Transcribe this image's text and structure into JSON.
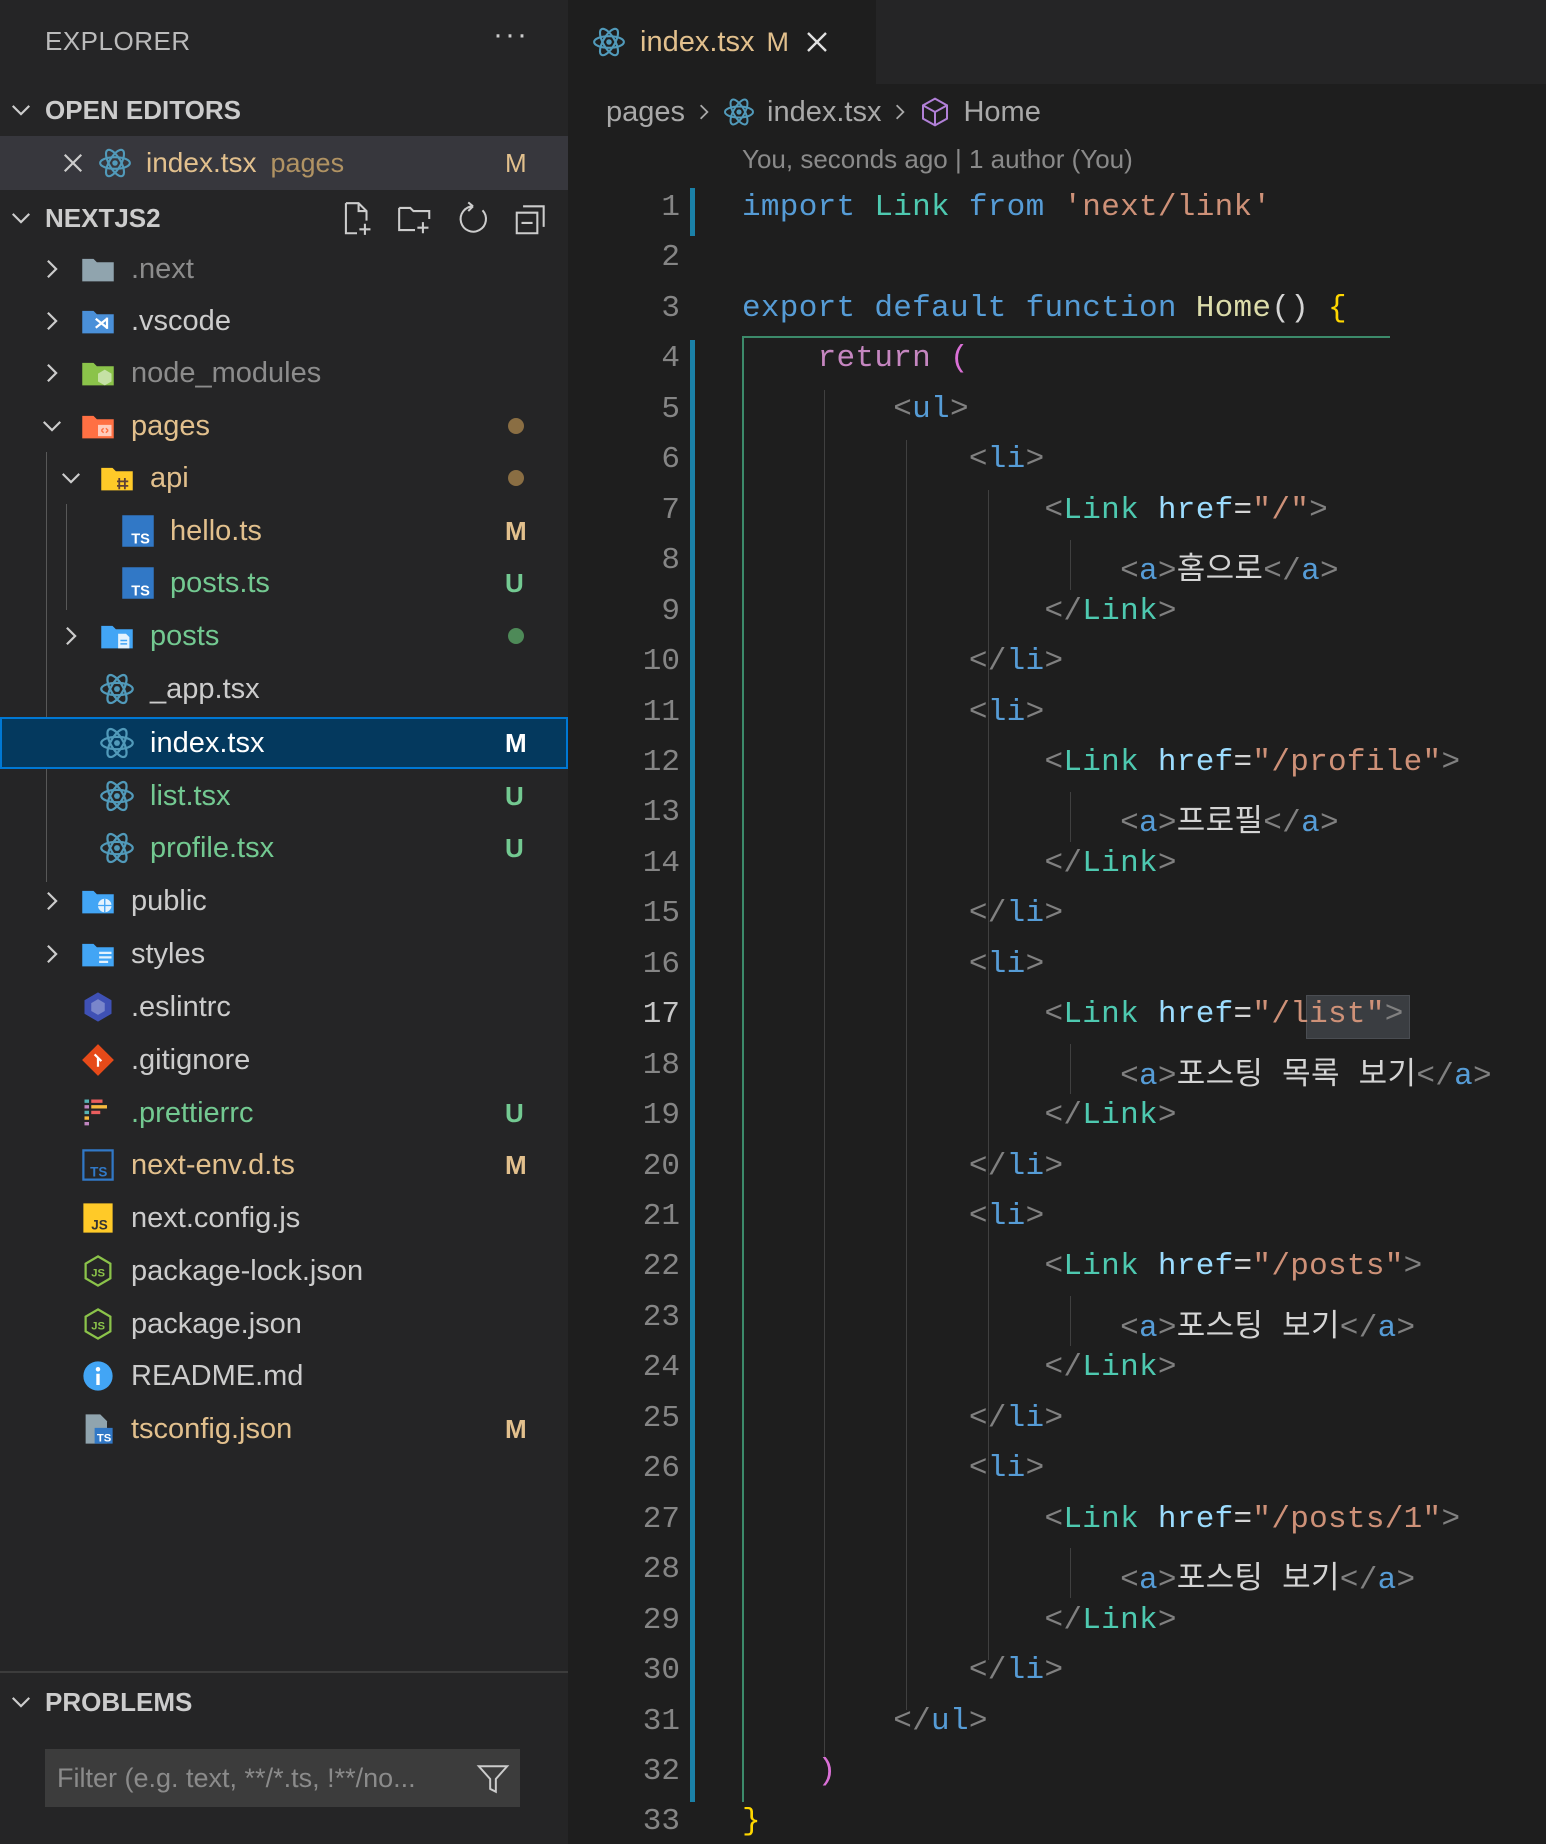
{
  "explorer": {
    "title": "EXPLORER",
    "more": "···",
    "open_editors": {
      "heading": "OPEN EDITORS",
      "items": [
        {
          "name": "index.tsx",
          "dir": "pages",
          "status": "M"
        }
      ]
    },
    "project": {
      "heading": "NEXTJS2",
      "tools": [
        "new-file-icon",
        "new-folder-icon",
        "refresh-icon",
        "collapse-all-icon"
      ],
      "tree": [
        {
          "label": ".next",
          "status": "",
          "dot": ""
        },
        {
          "label": ".vscode",
          "status": "",
          "dot": ""
        },
        {
          "label": "node_modules",
          "status": "",
          "dot": ""
        },
        {
          "label": "pages",
          "status": "",
          "dot": "#8a6e43"
        },
        {
          "label": "api",
          "status": "",
          "dot": "#8a6e43"
        },
        {
          "label": "hello.ts",
          "status": "M",
          "dot": ""
        },
        {
          "label": "posts.ts",
          "status": "U",
          "dot": ""
        },
        {
          "label": "posts",
          "status": "",
          "dot": "#4e8a58"
        },
        {
          "label": "_app.tsx",
          "status": "",
          "dot": ""
        },
        {
          "label": "index.tsx",
          "status": "M",
          "dot": ""
        },
        {
          "label": "list.tsx",
          "status": "U",
          "dot": ""
        },
        {
          "label": "profile.tsx",
          "status": "U",
          "dot": ""
        },
        {
          "label": "public",
          "status": "",
          "dot": ""
        },
        {
          "label": "styles",
          "status": "",
          "dot": ""
        },
        {
          "label": ".eslintrc",
          "status": "",
          "dot": ""
        },
        {
          "label": ".gitignore",
          "status": "",
          "dot": ""
        },
        {
          "label": ".prettierrc",
          "status": "U",
          "dot": ""
        },
        {
          "label": "next-env.d.ts",
          "status": "M",
          "dot": ""
        },
        {
          "label": "next.config.js",
          "status": "",
          "dot": ""
        },
        {
          "label": "package-lock.json",
          "status": "",
          "dot": ""
        },
        {
          "label": "package.json",
          "status": "",
          "dot": ""
        },
        {
          "label": "README.md",
          "status": "",
          "dot": ""
        },
        {
          "label": "tsconfig.json",
          "status": "M",
          "dot": ""
        }
      ]
    },
    "problems": {
      "heading": "PROBLEMS",
      "filter_placeholder": "Filter (e.g. text, **/*.ts, !**/no..."
    }
  },
  "editor": {
    "tab": {
      "name": "index.tsx",
      "status": "M"
    },
    "breadcrumb": {
      "folder": "pages",
      "file": "index.tsx",
      "symbol": "Home"
    },
    "blame": "You, seconds ago | 1 author (You)",
    "active_line": 17,
    "lines": [
      [
        "1"
      ],
      [
        "2"
      ],
      [
        "3"
      ],
      [
        "4"
      ],
      [
        "5"
      ],
      [
        "6"
      ],
      [
        "7"
      ],
      [
        "8"
      ],
      [
        "9"
      ],
      [
        "10"
      ],
      [
        "11"
      ],
      [
        "12"
      ],
      [
        "13"
      ],
      [
        "14"
      ],
      [
        "15"
      ],
      [
        "16"
      ],
      [
        "17"
      ],
      [
        "18"
      ],
      [
        "19"
      ],
      [
        "20"
      ],
      [
        "21"
      ],
      [
        "22"
      ],
      [
        "23"
      ],
      [
        "24"
      ],
      [
        "25"
      ],
      [
        "26"
      ],
      [
        "27"
      ],
      [
        "28"
      ],
      [
        "29"
      ],
      [
        "30"
      ],
      [
        "31"
      ],
      [
        "32"
      ],
      [
        "33"
      ]
    ],
    "code": [
      [
        [
          "kw",
          "import"
        ],
        [
          "txt",
          " "
        ],
        [
          "var",
          "Link"
        ],
        [
          "txt",
          " "
        ],
        [
          "kw",
          "from"
        ],
        [
          "txt",
          " "
        ],
        [
          "str",
          "'next/link'"
        ]
      ],
      [],
      [
        [
          "kw",
          "export"
        ],
        [
          "txt",
          " "
        ],
        [
          "kw",
          "default"
        ],
        [
          "txt",
          " "
        ],
        [
          "kw",
          "function"
        ],
        [
          "txt",
          " "
        ],
        [
          "fn",
          "Home"
        ],
        [
          "txt",
          "() "
        ],
        [
          "brace",
          "{"
        ]
      ],
      [
        [
          "txt",
          "    "
        ],
        [
          "ctl",
          "return"
        ],
        [
          "txt",
          " "
        ],
        [
          "brace2",
          "("
        ]
      ],
      [
        [
          "txt",
          "        "
        ],
        [
          "punc",
          "<"
        ],
        [
          "tag",
          "ul"
        ],
        [
          "punc",
          ">"
        ]
      ],
      [
        [
          "txt",
          "            "
        ],
        [
          "punc",
          "<"
        ],
        [
          "tag",
          "li"
        ],
        [
          "punc",
          ">"
        ]
      ],
      [
        [
          "txt",
          "                "
        ],
        [
          "punc",
          "<"
        ],
        [
          "comp",
          "Link"
        ],
        [
          "txt",
          " "
        ],
        [
          "attr",
          "href"
        ],
        [
          "txt",
          "="
        ],
        [
          "str",
          "\"/\""
        ],
        [
          "punc",
          ">"
        ]
      ],
      [
        [
          "txt",
          "                    "
        ],
        [
          "punc",
          "<"
        ],
        [
          "tag",
          "a"
        ],
        [
          "punc",
          ">"
        ],
        [
          "txt",
          "홈으로"
        ],
        [
          "punc",
          "</"
        ],
        [
          "tag",
          "a"
        ],
        [
          "punc",
          ">"
        ]
      ],
      [
        [
          "txt",
          "                "
        ],
        [
          "punc",
          "</"
        ],
        [
          "comp",
          "Link"
        ],
        [
          "punc",
          ">"
        ]
      ],
      [
        [
          "txt",
          "            "
        ],
        [
          "punc",
          "</"
        ],
        [
          "tag",
          "li"
        ],
        [
          "punc",
          ">"
        ]
      ],
      [
        [
          "txt",
          "            "
        ],
        [
          "punc",
          "<"
        ],
        [
          "tag",
          "li"
        ],
        [
          "punc",
          ">"
        ]
      ],
      [
        [
          "txt",
          "                "
        ],
        [
          "punc",
          "<"
        ],
        [
          "comp",
          "Link"
        ],
        [
          "txt",
          " "
        ],
        [
          "attr",
          "href"
        ],
        [
          "txt",
          "="
        ],
        [
          "str",
          "\"/profile\""
        ],
        [
          "punc",
          ">"
        ]
      ],
      [
        [
          "txt",
          "                    "
        ],
        [
          "punc",
          "<"
        ],
        [
          "tag",
          "a"
        ],
        [
          "punc",
          ">"
        ],
        [
          "txt",
          "프로필"
        ],
        [
          "punc",
          "</"
        ],
        [
          "tag",
          "a"
        ],
        [
          "punc",
          ">"
        ]
      ],
      [
        [
          "txt",
          "                "
        ],
        [
          "punc",
          "</"
        ],
        [
          "comp",
          "Link"
        ],
        [
          "punc",
          ">"
        ]
      ],
      [
        [
          "txt",
          "            "
        ],
        [
          "punc",
          "</"
        ],
        [
          "tag",
          "li"
        ],
        [
          "punc",
          ">"
        ]
      ],
      [
        [
          "txt",
          "            "
        ],
        [
          "punc",
          "<"
        ],
        [
          "tag",
          "li"
        ],
        [
          "punc",
          ">"
        ]
      ],
      [
        [
          "txt",
          "                "
        ],
        [
          "punc",
          "<"
        ],
        [
          "comp",
          "Link"
        ],
        [
          "txt",
          " "
        ],
        [
          "attr",
          "href"
        ],
        [
          "txt",
          "="
        ],
        [
          "str",
          "\"/list\""
        ],
        [
          "punc",
          ">"
        ]
      ],
      [
        [
          "txt",
          "                    "
        ],
        [
          "punc",
          "<"
        ],
        [
          "tag",
          "a"
        ],
        [
          "punc",
          ">"
        ],
        [
          "txt",
          "포스팅 목록 보기"
        ],
        [
          "punc",
          "</"
        ],
        [
          "tag",
          "a"
        ],
        [
          "punc",
          ">"
        ]
      ],
      [
        [
          "txt",
          "                "
        ],
        [
          "punc",
          "</"
        ],
        [
          "comp",
          "Link"
        ],
        [
          "punc",
          ">"
        ]
      ],
      [
        [
          "txt",
          "            "
        ],
        [
          "punc",
          "</"
        ],
        [
          "tag",
          "li"
        ],
        [
          "punc",
          ">"
        ]
      ],
      [
        [
          "txt",
          "            "
        ],
        [
          "punc",
          "<"
        ],
        [
          "tag",
          "li"
        ],
        [
          "punc",
          ">"
        ]
      ],
      [
        [
          "txt",
          "                "
        ],
        [
          "punc",
          "<"
        ],
        [
          "comp",
          "Link"
        ],
        [
          "txt",
          " "
        ],
        [
          "attr",
          "href"
        ],
        [
          "txt",
          "="
        ],
        [
          "str",
          "\"/posts\""
        ],
        [
          "punc",
          ">"
        ]
      ],
      [
        [
          "txt",
          "                    "
        ],
        [
          "punc",
          "<"
        ],
        [
          "tag",
          "a"
        ],
        [
          "punc",
          ">"
        ],
        [
          "txt",
          "포스팅 보기"
        ],
        [
          "punc",
          "</"
        ],
        [
          "tag",
          "a"
        ],
        [
          "punc",
          ">"
        ]
      ],
      [
        [
          "txt",
          "                "
        ],
        [
          "punc",
          "</"
        ],
        [
          "comp",
          "Link"
        ],
        [
          "punc",
          ">"
        ]
      ],
      [
        [
          "txt",
          "            "
        ],
        [
          "punc",
          "</"
        ],
        [
          "tag",
          "li"
        ],
        [
          "punc",
          ">"
        ]
      ],
      [
        [
          "txt",
          "            "
        ],
        [
          "punc",
          "<"
        ],
        [
          "tag",
          "li"
        ],
        [
          "punc",
          ">"
        ]
      ],
      [
        [
          "txt",
          "                "
        ],
        [
          "punc",
          "<"
        ],
        [
          "comp",
          "Link"
        ],
        [
          "txt",
          " "
        ],
        [
          "attr",
          "href"
        ],
        [
          "txt",
          "="
        ],
        [
          "str",
          "\"/posts/1\""
        ],
        [
          "punc",
          ">"
        ]
      ],
      [
        [
          "txt",
          "                    "
        ],
        [
          "punc",
          "<"
        ],
        [
          "tag",
          "a"
        ],
        [
          "punc",
          ">"
        ],
        [
          "txt",
          "포스팅 보기"
        ],
        [
          "punc",
          "</"
        ],
        [
          "tag",
          "a"
        ],
        [
          "punc",
          ">"
        ]
      ],
      [
        [
          "txt",
          "                "
        ],
        [
          "punc",
          "</"
        ],
        [
          "comp",
          "Link"
        ],
        [
          "punc",
          ">"
        ]
      ],
      [
        [
          "txt",
          "            "
        ],
        [
          "punc",
          "</"
        ],
        [
          "tag",
          "li"
        ],
        [
          "punc",
          ">"
        ]
      ],
      [
        [
          "txt",
          "        "
        ],
        [
          "punc",
          "</"
        ],
        [
          "tag",
          "ul"
        ],
        [
          "punc",
          ">"
        ]
      ],
      [
        [
          "txt",
          "    "
        ],
        [
          "brace2",
          ")"
        ]
      ],
      [
        [
          "brace",
          "}"
        ]
      ]
    ]
  },
  "colors": {
    "modified": "#e2c08d",
    "untracked": "#73c991",
    "accent": "#0078d4",
    "selection_bg": "#04395e"
  }
}
